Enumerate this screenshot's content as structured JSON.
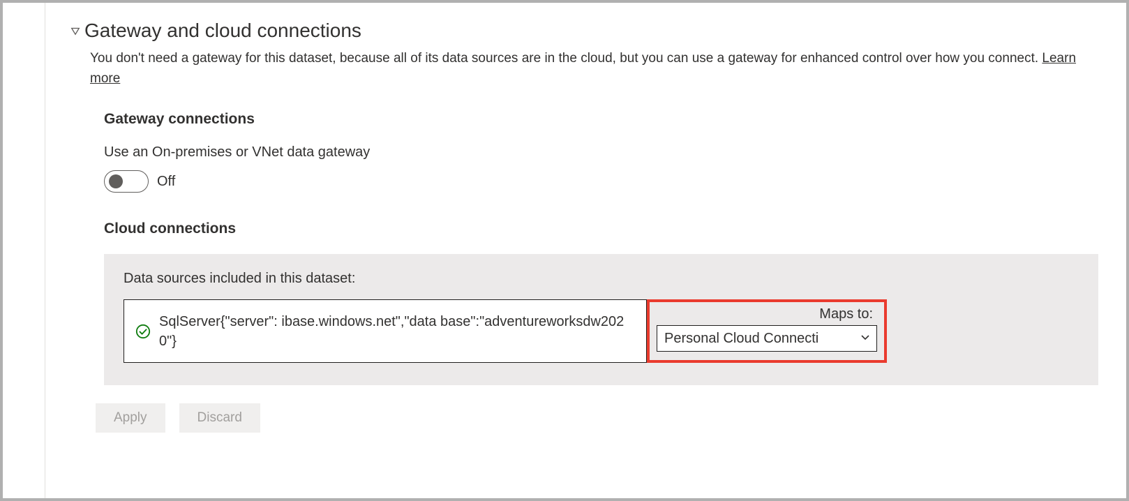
{
  "section": {
    "title": "Gateway and cloud connections",
    "description_prefix": "You don't need a gateway for this dataset, because all of its data sources are in the cloud, but you can use a gateway for enhanced control over how you connect. ",
    "learn_more": "Learn more"
  },
  "gateway": {
    "heading": "Gateway connections",
    "toggle_label": "Use an On-premises or VNet data gateway",
    "toggle_state": "Off",
    "toggle_on": false
  },
  "cloud": {
    "heading": "Cloud connections",
    "panel_caption": "Data sources included in this dataset:",
    "datasource_text": "SqlServer{\"server\":                      ibase.windows.net\",\"data base\":\"adventureworksdw2020\"}",
    "maps_to_label": "Maps to:",
    "maps_to_value": "Personal Cloud Connecti"
  },
  "buttons": {
    "apply": "Apply",
    "discard": "Discard"
  }
}
